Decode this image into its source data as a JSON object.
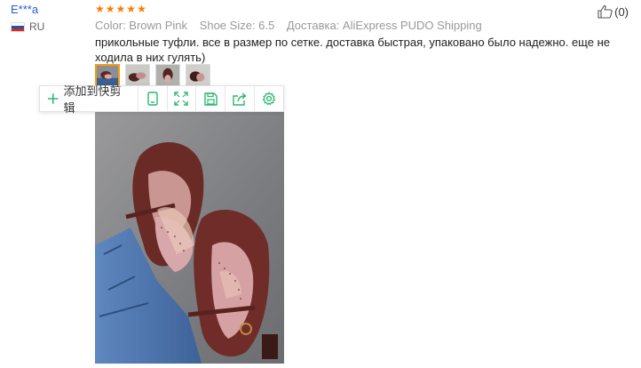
{
  "user": {
    "name": "E***a",
    "country": "RU"
  },
  "rating": {
    "stars": 5,
    "of": 5
  },
  "meta": {
    "color": "Color: Brown Pink",
    "size": "Shoe Size: 6.5",
    "shipping": "Доставка: AliExpress PUDO Shipping"
  },
  "review": {
    "text": "прикольные туфли. все в размер по сетке. доставка быстрая, упаковано было надежно. еще не ходила в них гулять)"
  },
  "helpful": {
    "count": "(0)"
  },
  "thumbnails": {
    "count": 4,
    "selected_index": 0
  },
  "toolbar": {
    "add_label": "添加到快剪辑",
    "buttons": [
      "phone-icon",
      "expand-icon",
      "save-icon",
      "share-icon",
      "settings-icon"
    ]
  },
  "colors": {
    "user_link": "#2b5bc8",
    "star": "#ff7a00",
    "meta": "#999999",
    "toolbar_icon": "#2bb673",
    "thumb_selected": "#f39c12"
  }
}
